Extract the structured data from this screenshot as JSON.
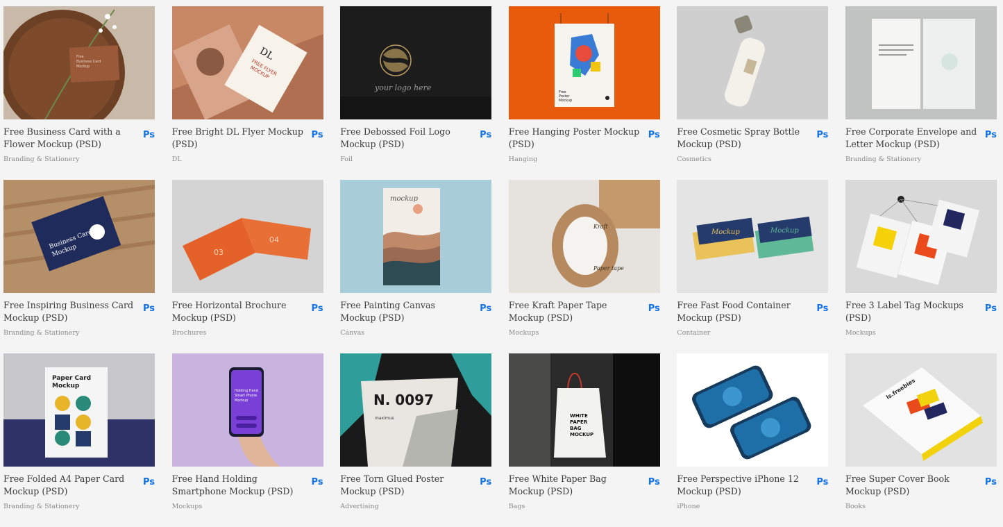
{
  "ps_label": "Ps",
  "cards": [
    {
      "title": "Free Business Card with a Flower Mockup (PSD)",
      "category": "Branding & Stationery",
      "thumb_text": [
        "Free",
        "Business Card",
        "Mockup"
      ]
    },
    {
      "title": "Free Bright DL Flyer Mockup (PSD)",
      "category": "DL",
      "thumb_text": [
        "DL",
        "FREE FLYER",
        "MOCKUP"
      ]
    },
    {
      "title": "Free Debossed Foil Logo Mockup (PSD)",
      "category": "Foil",
      "thumb_text": [
        "your logo here"
      ]
    },
    {
      "title": "Free Hanging Poster Mockup (PSD)",
      "category": "Hanging",
      "thumb_text": [
        "Free",
        "Poster",
        "Mockup"
      ]
    },
    {
      "title": "Free Cosmetic Spray Bottle Mockup (PSD)",
      "category": "Cosmetics",
      "thumb_text": []
    },
    {
      "title": "Free Corporate Envelope and Letter Mockup (PSD)",
      "category": "Branding & Stationery",
      "thumb_text": []
    },
    {
      "title": "Free Inspiring Business Card Mockup (PSD)",
      "category": "Branding & Stationery",
      "thumb_text": [
        "Business Card",
        "Mockup"
      ]
    },
    {
      "title": "Free Horizontal Brochure Mockup (PSD)",
      "category": "Brochures",
      "thumb_text": [
        "03",
        "04"
      ]
    },
    {
      "title": "Free Painting Canvas Mockup (PSD)",
      "category": "Canvas",
      "thumb_text": [
        "mockup"
      ]
    },
    {
      "title": "Free Kraft Paper Tape Mockup (PSD)",
      "category": "Mockups",
      "thumb_text": [
        "Kraft",
        "Paper tape"
      ]
    },
    {
      "title": "Free Fast Food Container Mockup (PSD)",
      "category": "Container",
      "thumb_text": [
        "Mockup",
        "Mockup"
      ]
    },
    {
      "title": "Free 3 Label Tag Mockups (PSD)",
      "category": "Mockups",
      "thumb_text": []
    },
    {
      "title": "Free Folded A4 Paper Card Mockup (PSD)",
      "category": "Branding & Stationery",
      "thumb_text": [
        "Paper Card",
        "Mockup"
      ]
    },
    {
      "title": "Free Hand Holding Smartphone Mockup (PSD)",
      "category": "Mockups",
      "thumb_text": [
        "Holding Hand",
        "Smart Phone",
        "Mockup"
      ]
    },
    {
      "title": "Free Torn Glued Poster Mockup (PSD)",
      "category": "Advertising",
      "thumb_text": [
        "N. 0097",
        "maximus"
      ]
    },
    {
      "title": "Free White Paper Bag Mockup (PSD)",
      "category": "Bags",
      "thumb_text": [
        "WHITE",
        "PAPER",
        "BAG",
        "MOCKUP"
      ]
    },
    {
      "title": "Free Perspective iPhone 12 Mockup (PSD)",
      "category": "iPhone",
      "thumb_text": []
    },
    {
      "title": "Free Super Cover Book Mockup (PSD)",
      "category": "Books",
      "thumb_text": [
        "ls.freebies"
      ]
    }
  ]
}
